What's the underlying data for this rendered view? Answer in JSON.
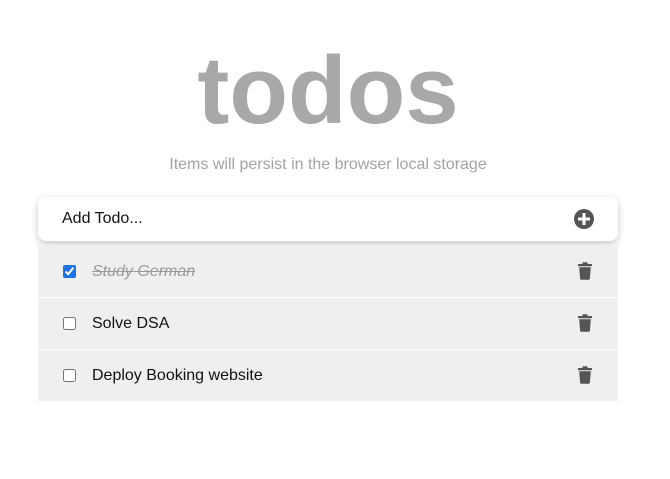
{
  "header": {
    "title": "todos",
    "subtitle": "Items will persist in the browser local storage"
  },
  "add_todo": {
    "placeholder": "Add Todo...",
    "value": "",
    "button_icon": "plus-circle-icon"
  },
  "todos": [
    {
      "label": "Study German",
      "completed": true,
      "delete_icon": "trash-icon"
    },
    {
      "label": "Solve DSA",
      "completed": false,
      "delete_icon": "trash-icon"
    },
    {
      "label": "Deploy Booking website",
      "completed": false,
      "delete_icon": "trash-icon"
    }
  ],
  "colors": {
    "title": "#a8a8a8",
    "subtitle": "#a3a3a3",
    "item_background": "#efefef",
    "icon": "#555555",
    "checkbox_accent": "#1a73e8"
  }
}
